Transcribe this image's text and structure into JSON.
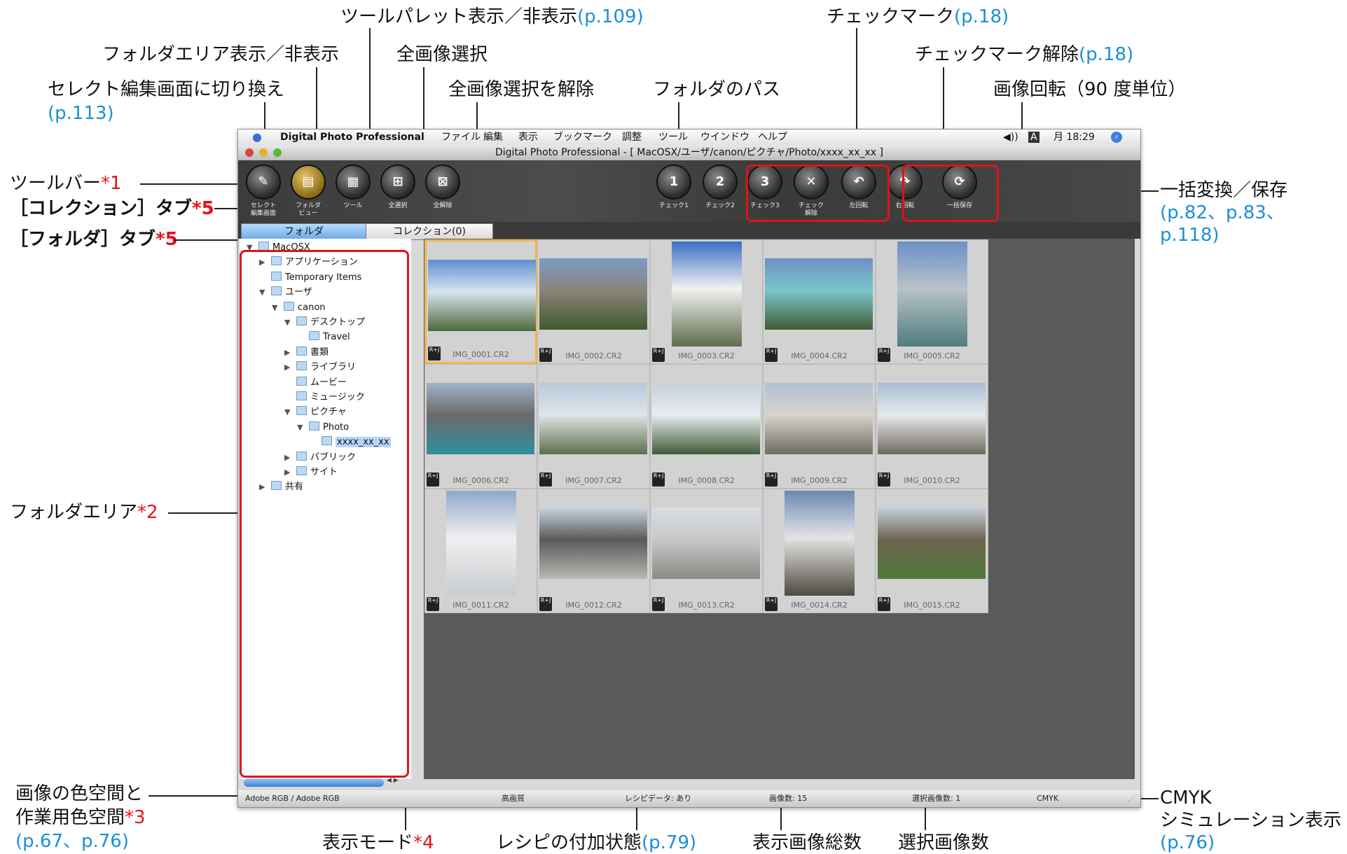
{
  "callouts": {
    "select_edit": {
      "text": "セレクト編集画面に切り換え",
      "ref": "(p.113)"
    },
    "folder_area_toggle": {
      "text": "フォルダエリア表示／非表示"
    },
    "tool_palette": {
      "text": "ツールパレット表示／非表示",
      "ref": "(p.109)"
    },
    "select_all": {
      "text": "全画像選択"
    },
    "deselect_all": {
      "text": "全画像選択を解除"
    },
    "folder_path": {
      "text": "フォルダのパス"
    },
    "check_mark": {
      "text": "チェックマーク",
      "ref": "(p.18)"
    },
    "check_clear": {
      "text": "チェックマーク解除",
      "ref": "(p.18)"
    },
    "rotate": {
      "text": "画像回転（90 度単位）"
    },
    "toolbar": {
      "text": "ツールバー",
      "star": "*1"
    },
    "collection_tab": {
      "text": "［コレクション］タブ",
      "star": "*5"
    },
    "folder_tab": {
      "text": "［フォルダ］タブ",
      "star": "*5"
    },
    "batch": {
      "text": "一括変換／保存",
      "ref1": "(p.82、p.83、",
      "ref2": "p.118)"
    },
    "folder_area": {
      "text": "フォルダエリア",
      "star": "*2"
    },
    "color_space": {
      "text1": "画像の色空間と",
      "text2": "作業用色空間",
      "star": "*3",
      "ref": "(p.67、p.76)"
    },
    "display_mode": {
      "text": "表示モード",
      "star": "*4"
    },
    "recipe": {
      "text": "レシピの付加状態",
      "ref": "(p.79)"
    },
    "total": {
      "text": "表示画像総数"
    },
    "selected": {
      "text": "選択画像数"
    },
    "cmyk": {
      "text1": "CMYK",
      "text2": "シミュレーション表示",
      "ref": "(p.76)"
    }
  },
  "menubar": {
    "app": "Digital Photo Professional",
    "items": [
      "ファイル",
      "編集",
      "表示",
      "ブックマーク",
      "調整",
      "ツール",
      "ウインドウ",
      "ヘルプ"
    ],
    "clock": "月 18:29",
    "input_icon": "A"
  },
  "window_title": "Digital Photo Professional - [ MacOSX/ユーザ/canon/ピクチャ/Photo/xxxx_xx_xx ]",
  "toolbar": {
    "buttons": [
      {
        "id": "select",
        "label1": "セレクト",
        "label2": "編集画面",
        "glyph": "✎"
      },
      {
        "id": "folderview",
        "label1": "フォルダ",
        "label2": "ビュー",
        "glyph": "▤"
      },
      {
        "id": "tool",
        "label1": "ツール",
        "label2": "",
        "glyph": "▦"
      },
      {
        "id": "selectall",
        "label1": "全選択",
        "label2": "",
        "glyph": "⊞"
      },
      {
        "id": "deselect",
        "label1": "全解除",
        "label2": "",
        "glyph": "⊠"
      },
      {
        "id": "check1",
        "label1": "チェック1",
        "label2": "",
        "glyph": "1"
      },
      {
        "id": "check2",
        "label1": "チェック2",
        "label2": "",
        "glyph": "2"
      },
      {
        "id": "check3",
        "label1": "チェック3",
        "label2": "",
        "glyph": "3"
      },
      {
        "id": "checkclear",
        "label1": "チェック",
        "label2": "解除",
        "glyph": "✕"
      },
      {
        "id": "rotl",
        "label1": "左回転",
        "label2": "",
        "glyph": "↶"
      },
      {
        "id": "rotr",
        "label1": "右回転",
        "label2": "",
        "glyph": "↷"
      },
      {
        "id": "batch",
        "label1": "一括保存",
        "label2": "",
        "glyph": "⟳"
      }
    ]
  },
  "tabs": {
    "folder": "フォルダ",
    "collection": "コレクション(0)"
  },
  "tree": [
    {
      "label": "MacOSX",
      "depth": 0,
      "tri": "▼"
    },
    {
      "label": "アプリケーション",
      "depth": 1,
      "tri": "▶"
    },
    {
      "label": "Temporary Items",
      "depth": 1,
      "tri": ""
    },
    {
      "label": "ユーザ",
      "depth": 1,
      "tri": "▼"
    },
    {
      "label": "canon",
      "depth": 2,
      "tri": "▼"
    },
    {
      "label": "デスクトップ",
      "depth": 3,
      "tri": "▼"
    },
    {
      "label": "Travel",
      "depth": 4,
      "tri": ""
    },
    {
      "label": "書類",
      "depth": 3,
      "tri": "▶"
    },
    {
      "label": "ライブラリ",
      "depth": 3,
      "tri": "▶"
    },
    {
      "label": "ムービー",
      "depth": 3,
      "tri": ""
    },
    {
      "label": "ミュージック",
      "depth": 3,
      "tri": ""
    },
    {
      "label": "ピクチャ",
      "depth": 3,
      "tri": "▼"
    },
    {
      "label": "Photo",
      "depth": 4,
      "tri": "▼"
    },
    {
      "label": "xxxx_xx_xx",
      "depth": 5,
      "tri": ""
    },
    {
      "label": "パブリック",
      "depth": 3,
      "tri": "▶"
    },
    {
      "label": "サイト",
      "depth": 3,
      "tri": "▶"
    },
    {
      "label": "共有",
      "depth": 1,
      "tri": "▶"
    }
  ],
  "images": [
    {
      "name": "IMG_0001.CR2",
      "badge": "R+J"
    },
    {
      "name": "IMG_0002.CR2",
      "badge": "R+J"
    },
    {
      "name": "IMG_0003.CR2",
      "badge": "R+J"
    },
    {
      "name": "IMG_0004.CR2",
      "badge": "R+J"
    },
    {
      "name": "IMG_0005.CR2",
      "badge": "R+J"
    },
    {
      "name": "IMG_0006.CR2",
      "badge": "R+J"
    },
    {
      "name": "IMG_0007.CR2",
      "badge": "R+J"
    },
    {
      "name": "IMG_0008.CR2",
      "badge": "R+J"
    },
    {
      "name": "IMG_0009.CR2",
      "badge": "R+J"
    },
    {
      "name": "IMG_0010.CR2",
      "badge": "R+J"
    },
    {
      "name": "IMG_0011.CR2",
      "badge": "R+J"
    },
    {
      "name": "IMG_0012.CR2",
      "badge": "R+J"
    },
    {
      "name": "IMG_0013.CR2",
      "badge": "R+J"
    },
    {
      "name": "IMG_0014.CR2",
      "badge": "R+J"
    },
    {
      "name": "IMG_0015.CR2",
      "badge": "R+J"
    }
  ],
  "status": {
    "colorspace": "Adobe RGB / Adobe RGB",
    "quality": "高画質",
    "recipe": "レシピデータ: あり",
    "count": "画像数: 15",
    "selected": "選択画像数: 1",
    "cmyk": "CMYK"
  },
  "colors": {
    "accent_red": "#e3101a",
    "reference_blue": "#1a8fd6",
    "selection_orange": "#f0b54a"
  }
}
